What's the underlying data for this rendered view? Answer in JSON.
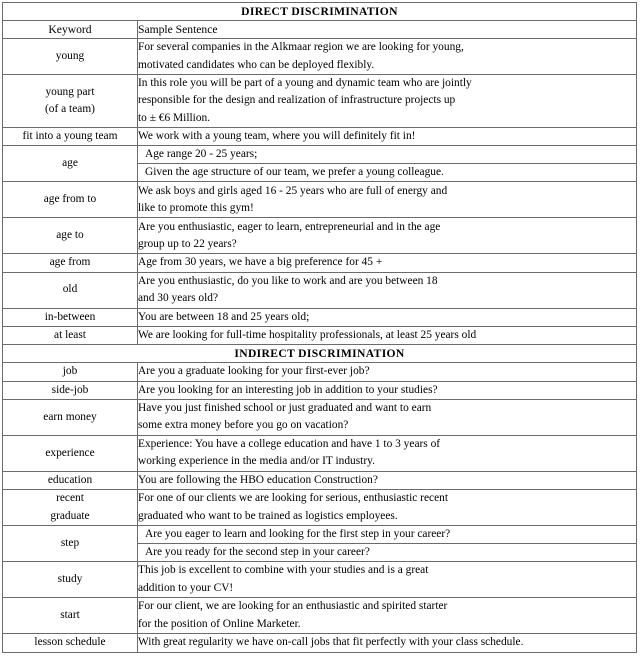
{
  "document": {
    "columns": {
      "keyword_header": "Keyword",
      "sentence_header": "Sample Sentence"
    },
    "sections": [
      {
        "title": "DIRECT DISCRIMINATION",
        "rows": [
          {
            "keyword_lines": [
              "young"
            ],
            "sentences": [
              [
                "For several companies in the Alkmaar region we are looking for young,",
                "motivated candidates who can be deployed flexibly."
              ]
            ]
          },
          {
            "keyword_lines": [
              "young part",
              "(of a team)"
            ],
            "sentences": [
              [
                "In this role you will be part of a young and dynamic team who are jointly",
                "responsible for the design and realization of infrastructure projects up",
                "to ± €6 Million."
              ]
            ]
          },
          {
            "keyword_lines": [
              "fit into a young team"
            ],
            "sentences": [
              [
                "We work with a young team, where you will definitely fit in!"
              ]
            ]
          },
          {
            "keyword_lines": [
              "age"
            ],
            "sentences": [
              [
                "Age range 20 - 25 years;"
              ],
              [
                "Given the age structure of our team, we prefer a young colleague."
              ]
            ]
          },
          {
            "keyword_lines": [
              "age from to"
            ],
            "sentences": [
              [
                "We ask boys and girls aged 16 - 25 years who are full of energy and",
                "like to promote this gym!"
              ]
            ]
          },
          {
            "keyword_lines": [
              "age to"
            ],
            "sentences": [
              [
                "Are you enthusiastic, eager to learn, entrepreneurial and in the age",
                "group up to 22 years?"
              ]
            ]
          },
          {
            "keyword_lines": [
              "age from"
            ],
            "sentences": [
              [
                "Age from 30 years, we have a big preference for 45 +"
              ]
            ]
          },
          {
            "keyword_lines": [
              "old"
            ],
            "sentences": [
              [
                "Are you enthusiastic, do you like to work and are you between 18",
                "and 30 years old?"
              ]
            ]
          },
          {
            "keyword_lines": [
              "in-between"
            ],
            "sentences": [
              [
                "You are between 18 and 25 years old;"
              ]
            ]
          },
          {
            "keyword_lines": [
              "at least"
            ],
            "sentences": [
              [
                "We are looking for full-time hospitality professionals, at least 25 years old"
              ]
            ]
          }
        ]
      },
      {
        "title": "INDIRECT DISCRIMINATION",
        "rows": [
          {
            "keyword_lines": [
              "job"
            ],
            "sentences": [
              [
                "Are you a graduate looking for your first-ever job?"
              ]
            ]
          },
          {
            "keyword_lines": [
              "side-job"
            ],
            "sentences": [
              [
                "Are you looking for an interesting job in addition to your studies?"
              ]
            ]
          },
          {
            "keyword_lines": [
              "earn money"
            ],
            "sentences": [
              [
                "Have you just finished school or just graduated and want to earn",
                "some extra money before you go on vacation?"
              ]
            ]
          },
          {
            "keyword_lines": [
              "experience"
            ],
            "sentences": [
              [
                "Experience:  You have a college education and have 1 to 3 years of",
                "working experience in the media and/or IT industry."
              ]
            ]
          },
          {
            "keyword_lines": [
              "education"
            ],
            "sentences": [
              [
                "You are following the HBO education Construction?"
              ]
            ]
          },
          {
            "keyword_lines": [
              "recent",
              "graduate"
            ],
            "sentences": [
              [
                "For one of our clients we are looking for serious, enthusiastic recent",
                "graduated who want to be trained as logistics employees."
              ]
            ]
          },
          {
            "keyword_lines": [
              "step"
            ],
            "sentences": [
              [
                "Are you eager to learn and looking for the first step in your career?"
              ],
              [
                "Are you ready for the second step in your career?"
              ]
            ]
          },
          {
            "keyword_lines": [
              "study"
            ],
            "sentences": [
              [
                "This job is excellent to combine with your studies and is a great",
                "addition to your CV!"
              ]
            ]
          },
          {
            "keyword_lines": [
              "start"
            ],
            "sentences": [
              [
                "For our client, we are looking for an enthusiastic and spirited starter",
                "for the position of Online Marketer."
              ]
            ]
          },
          {
            "keyword_lines": [
              "lesson schedule"
            ],
            "sentences": [
              [
                "With great regularity we have on-call jobs that fit perfectly with your class schedule."
              ]
            ]
          }
        ]
      }
    ]
  }
}
